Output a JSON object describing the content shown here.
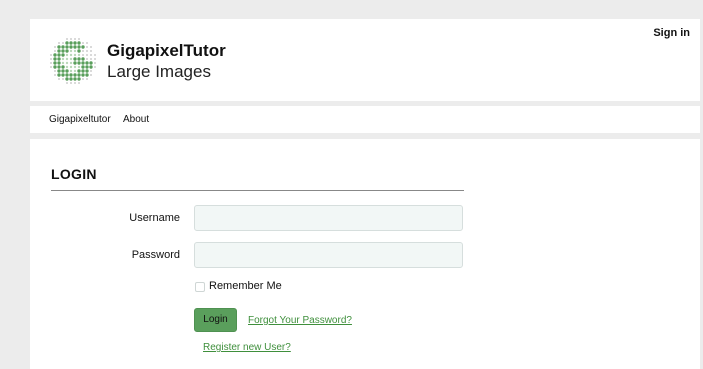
{
  "header": {
    "brand_title": "GigapixelTutor",
    "brand_subtitle": "Large Images",
    "sign_in": "Sign in",
    "logo_icon": "gigapixel-dot-grid-logo"
  },
  "nav": {
    "items": [
      {
        "label": "Gigapixeltutor"
      },
      {
        "label": "About"
      }
    ]
  },
  "login": {
    "heading": "LOGIN",
    "username_label": "Username",
    "username_value": "",
    "password_label": "Password",
    "password_value": "",
    "remember_label": "Remember Me",
    "remember_checked": false,
    "submit_label": "Login",
    "forgot_link": "Forgot Your Password?",
    "register_link": "Register new User?"
  },
  "colors": {
    "accent": "#5a9f5c",
    "link": "#3f8f3c",
    "input_bg": "#f2f7f6",
    "page_bg": "#ececec"
  }
}
